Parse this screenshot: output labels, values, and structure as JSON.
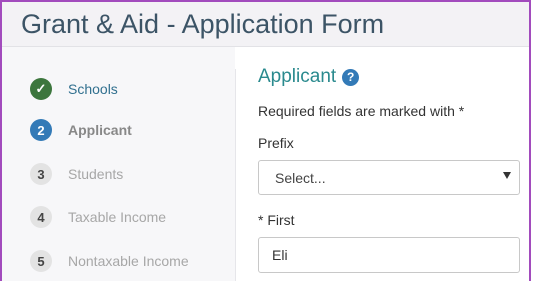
{
  "header": {
    "title": "Grant & Aid - Application Form"
  },
  "sidebar": {
    "steps": [
      {
        "number": "✓",
        "label": "Schools",
        "state": "done"
      },
      {
        "number": "2",
        "label": "Applicant",
        "state": "active"
      },
      {
        "number": "3",
        "label": "Students",
        "state": "pending"
      },
      {
        "number": "4",
        "label": "Taxable Income",
        "state": "pending"
      },
      {
        "number": "5",
        "label": "Nontaxable Income",
        "state": "pending"
      }
    ]
  },
  "main": {
    "section_title": "Applicant",
    "help_icon": "?",
    "required_note": "Required fields are marked with *",
    "prefix": {
      "label": "Prefix",
      "value": "Select..."
    },
    "first": {
      "label": "* First",
      "value": "Eli"
    }
  },
  "colors": {
    "frame": "#a24bbd",
    "done": "#3c763d",
    "active": "#337ab7",
    "section_title": "#2a8a8e"
  }
}
